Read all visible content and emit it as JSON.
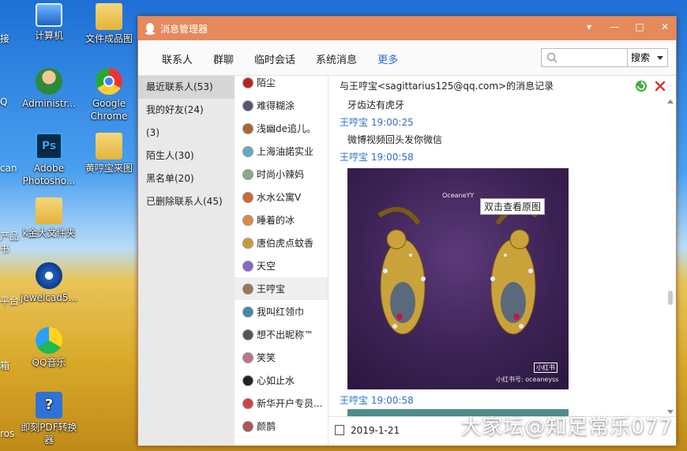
{
  "desktop": {
    "icons": [
      {
        "label": "计算机",
        "type": "pc"
      },
      {
        "label": "文件成品图",
        "type": "folder"
      },
      {
        "label": "Administr...",
        "type": "user"
      },
      {
        "label": "Google Chrome",
        "type": "chrome"
      },
      {
        "label": "Adobe Photosho...",
        "type": "ps",
        "glyph": "Ps"
      },
      {
        "label": "黄哼宝来图",
        "type": "folder"
      },
      {
        "label": "k金大文件夹",
        "type": "folder"
      },
      {
        "label": "jewelcad5...",
        "type": "jewel"
      },
      {
        "label": "QQ音乐",
        "type": "music"
      },
      {
        "label": "即刻PDF转换器",
        "type": "pdf",
        "glyph": "?"
      }
    ],
    "edge_labels": [
      "接",
      "Q",
      "can",
      "产品",
      "书",
      "平台",
      "箱",
      "ros"
    ]
  },
  "window": {
    "title": "消息管理器",
    "controls": [
      "▾",
      "—",
      "□",
      "✕"
    ],
    "tabs": [
      "联系人",
      "群聊",
      "临时会话",
      "系统消息",
      "更多"
    ],
    "active_tab": 4,
    "search_button": "搜索"
  },
  "groups": [
    "最近联系人(53)",
    "我的好友(24)",
    "(3)",
    "陌生人(30)",
    "黑名单(20)",
    "已删除联系人(45)"
  ],
  "contacts": [
    {
      "name": "陌尘",
      "color": "#b22"
    },
    {
      "name": "难得糊涂",
      "color": "#557"
    },
    {
      "name": "浅幽de追儿。",
      "color": "#a63"
    },
    {
      "name": "上海油諾实业",
      "color": "#6ab"
    },
    {
      "name": "时尚小辣妈",
      "color": "#8a8"
    },
    {
      "name": "水水公寓V",
      "color": "#c63"
    },
    {
      "name": "睡着的冰",
      "color": "#d84"
    },
    {
      "name": "唐伯虎点蚊香",
      "color": "#c93"
    },
    {
      "name": "天空",
      "color": "#86c"
    },
    {
      "name": "王哼宝",
      "color": "#975"
    },
    {
      "name": "我叫红领巾",
      "color": "#48a"
    },
    {
      "name": "想不出昵称™",
      "color": "#555"
    },
    {
      "name": "笑笑",
      "color": "#b78"
    },
    {
      "name": "心如止水",
      "color": "#222"
    },
    {
      "name": "新华开户专员...",
      "color": "#c44"
    },
    {
      "name": "颜鹊",
      "color": "#a55"
    }
  ],
  "active_contact": 9,
  "chat": {
    "header": "与王哼宝<sagittarius125@qq.com>的消息记录",
    "messages": [
      {
        "kind": "text",
        "text": "牙齿达有虎牙"
      },
      {
        "kind": "sender",
        "text": "王哼宝 19:00:25"
      },
      {
        "kind": "text",
        "text": "微博视频回头发你微信"
      },
      {
        "kind": "sender",
        "text": "王哼宝 19:00:58"
      },
      {
        "kind": "image",
        "hint": "双击查看原图",
        "wm1": "OceaneYY",
        "wm2": "小红书号: oceaneyss",
        "wm3": "小红书"
      },
      {
        "kind": "sender",
        "text": "王哼宝 19:00:58"
      }
    ],
    "date": "2019-1-21"
  },
  "watermark": "大家坛@知足常乐077",
  "colors": {
    "titlebar": "#e58a5c",
    "accent": "#2a6fcf"
  }
}
